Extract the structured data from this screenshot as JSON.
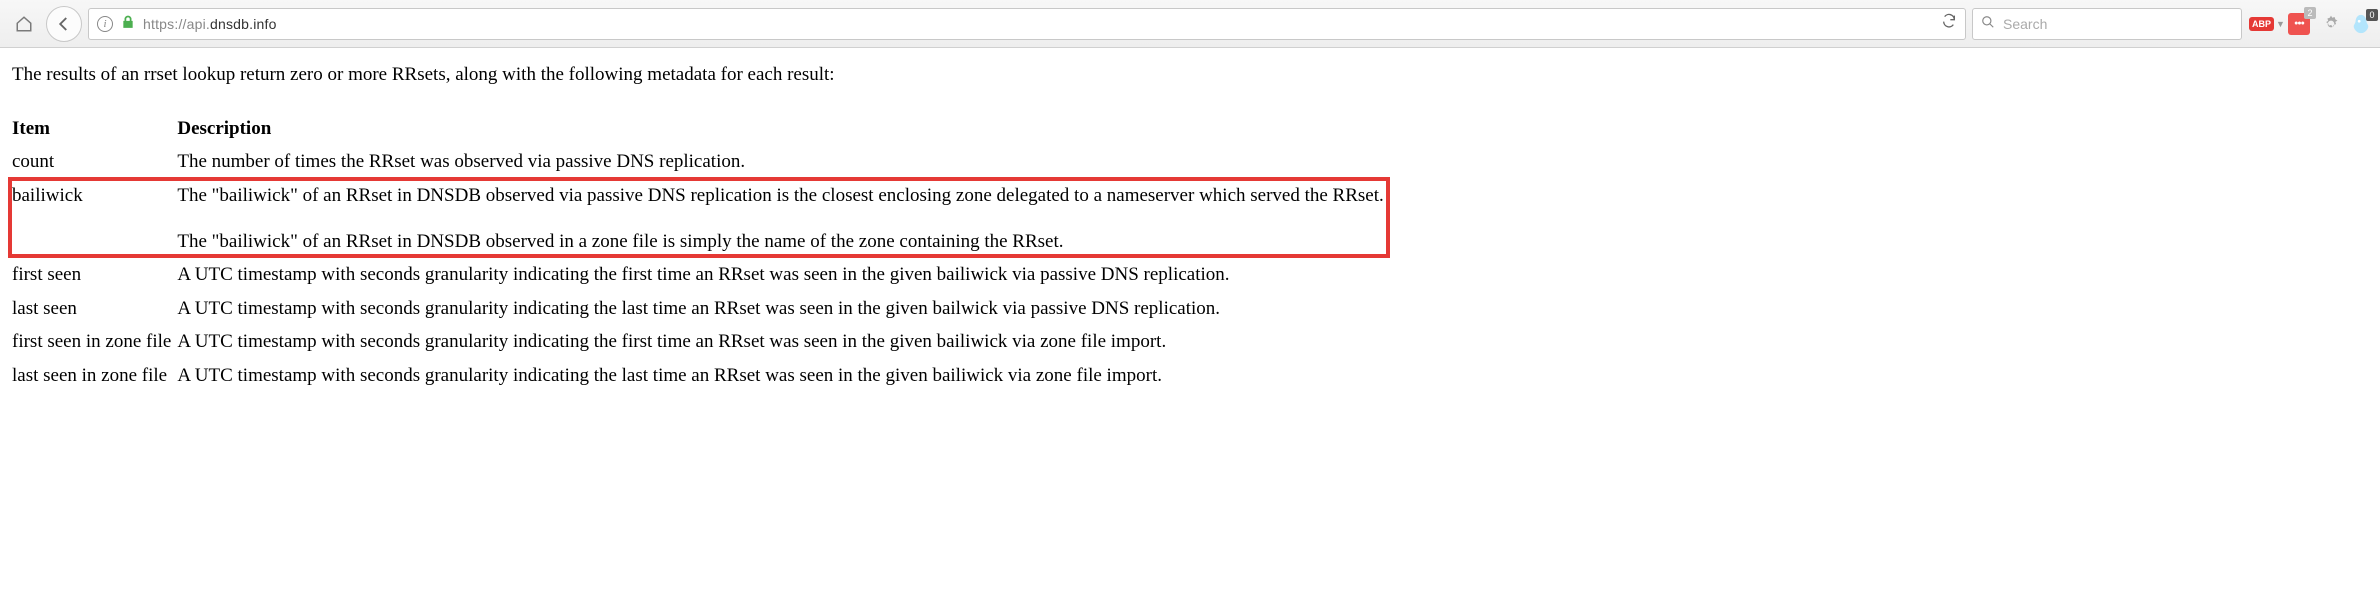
{
  "toolbar": {
    "url_prefix": "https://api.",
    "url_domain": "dnsdb.info",
    "search_placeholder": "Search",
    "abp_label": "ABP",
    "ext_dots": "●●●",
    "ext_badge_count": "2",
    "blue_badge_count": "0"
  },
  "page": {
    "intro": "The results of an rrset lookup return zero or more RRsets, along with the following metadata for each result:",
    "headers": {
      "item": "Item",
      "description": "Description"
    },
    "rows": [
      {
        "item": "count",
        "description": "The number of times the RRset was observed via passive DNS replication."
      },
      {
        "item": "bailiwick",
        "description_p1": "The \"bailiwick\" of an RRset in DNSDB observed via passive DNS replication is the closest enclosing zone delegated to a nameserver which served the RRset.",
        "description_p2": "The \"bailiwick\" of an RRset in DNSDB observed in a zone file is simply the name of the zone containing the RRset.",
        "highlighted": true
      },
      {
        "item": "first seen",
        "description": "A UTC timestamp with seconds granularity indicating the first time an RRset was seen in the given bailiwick via passive DNS replication."
      },
      {
        "item": "last seen",
        "description": "A UTC timestamp with seconds granularity indicating the last time an RRset was seen in the given bailwick via passive DNS replication."
      },
      {
        "item": "first seen in zone file",
        "description": "A UTC timestamp with seconds granularity indicating the first time an RRset was seen in the given bailiwick via zone file import."
      },
      {
        "item": "last seen in zone file",
        "description": "A UTC timestamp with seconds granularity indicating the last time an RRset was seen in the given bailiwick via zone file import."
      }
    ]
  }
}
